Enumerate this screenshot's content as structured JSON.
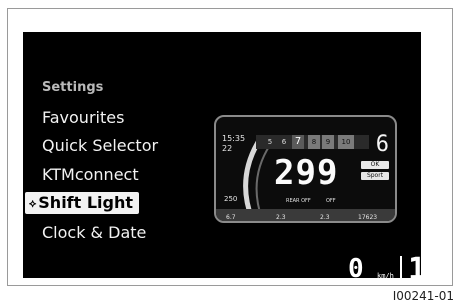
{
  "menu": {
    "title": "Settings",
    "items": [
      {
        "label": "Favourites",
        "selected": false
      },
      {
        "label": "Quick Selector",
        "selected": false
      },
      {
        "label": "KTMconnect",
        "selected": false
      },
      {
        "label": "Shift Light",
        "selected": true
      },
      {
        "label": "Clock & Date",
        "selected": false
      }
    ],
    "selected_marker_icon": "arrow-marker-icon"
  },
  "preview": {
    "clock": "15:35",
    "temperature": "22",
    "rpm_segments": [
      "5",
      "6",
      "7",
      "8",
      "9",
      "10"
    ],
    "gear": "6",
    "speed": "299",
    "chips": [
      "OK",
      "Sport"
    ],
    "fuel": "250",
    "labels": [
      "REAR OFF",
      "OFF"
    ],
    "footer_values": [
      "6.7",
      "2.3",
      "2.3",
      "17623"
    ]
  },
  "status": {
    "speed_value": "0",
    "speed_unit": "km/h",
    "gear": "1"
  },
  "figure_id": "I00241-01",
  "colors": {
    "screen_background": "#000000",
    "highlight": "#f2f2f2",
    "text": "#f2f2f2"
  }
}
